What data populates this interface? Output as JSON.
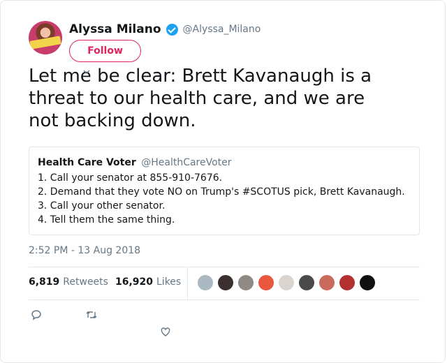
{
  "author": {
    "display_name": "Alyssa Milano",
    "handle": "@Alyssa_Milano",
    "verified": true
  },
  "follow_label": "Follow",
  "tweet": {
    "lines": [
      "Let me be clear: Brett Kavanaugh is a",
      "threat to our health care, and we are",
      "not backing down."
    ]
  },
  "quote": {
    "name": "Health Care Voter",
    "handle": "@HealthCareVoter",
    "lines": [
      "1. Call your senator at 855-910-7676.",
      "2. Demand that they vote NO on Trump's #SCOTUS pick, Brett Kavanaugh.",
      "3. Call your other senator.",
      "4. Tell them the same thing."
    ]
  },
  "timestamp": "2:52 PM - 13 Aug 2018",
  "stats": {
    "retweets_count": "6,819",
    "retweets_label": "Retweets",
    "likes_count": "16,920",
    "likes_label": "Likes"
  },
  "colors": {
    "accent": "#e0245e",
    "verified": "#1da1f2",
    "muted": "#657786",
    "border": "#e1e8ed"
  },
  "likers": [
    {
      "name": "default-avatar",
      "color": "#aab8c2"
    },
    {
      "name": "liker-2",
      "color": "#3b2f2f"
    },
    {
      "name": "liker-3",
      "color": "#8f8a84"
    },
    {
      "name": "liker-4",
      "color": "#e8573e"
    },
    {
      "name": "liker-5",
      "color": "#d9d4cf"
    },
    {
      "name": "liker-6",
      "color": "#4a4a4a"
    },
    {
      "name": "liker-7",
      "color": "#c96b5c"
    },
    {
      "name": "liker-8",
      "color": "#b0312f"
    },
    {
      "name": "liker-9",
      "color": "#111111"
    }
  ]
}
